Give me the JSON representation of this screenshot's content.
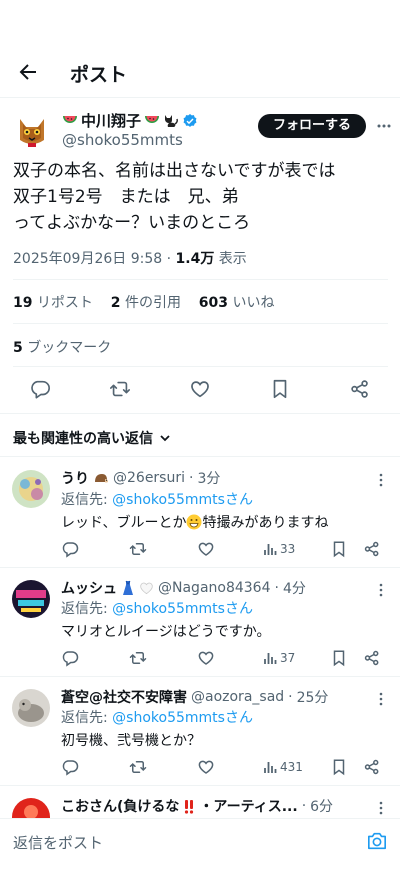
{
  "header": {
    "title": "ポスト"
  },
  "post": {
    "display_name": "中川翔子",
    "handle": "@shoko55mmts",
    "follow_label": "フォローする",
    "text": "双子の本名、名前は出さないですが表では\n双子1号2号　または　兄、弟\nってよぶかなー？いまのところ",
    "date": "2025年09月26日 9:58",
    "views_count": "1.4万",
    "views_label": "表示",
    "retweets_count": "19",
    "retweets_label": "リポスト",
    "quotes_count": "2",
    "quotes_label": "件の引用",
    "likes_count": "603",
    "likes_label": "いいね",
    "bookmarks_count": "5",
    "bookmarks_label": "ブックマーク"
  },
  "replies_sort": {
    "label": "最も関連性の高い返信"
  },
  "replies": [
    {
      "name": "うり",
      "handle": "@26ersuri",
      "time": "3分",
      "reply_to_prefix": "返信先: ",
      "reply_to": "@shoko55mmtsさん",
      "text_before": "レッド、ブルーとか",
      "text_after": "特撮みがありますね",
      "views": "33"
    },
    {
      "name": "ムッシュ",
      "handle": "@Nagano84364",
      "time": "4分",
      "reply_to_prefix": "返信先: ",
      "reply_to": "@shoko55mmtsさん",
      "text": "マリオとルイージはどうですか。",
      "views": "37"
    },
    {
      "name": "蒼空@社交不安障害",
      "handle": "@aozora_sad",
      "time": "25分",
      "reply_to_prefix": "返信先: ",
      "reply_to": "@shoko55mmtsさん",
      "text": "初号機、弐号機とか？",
      "views": "431"
    },
    {
      "name": "こおさん(負けるな",
      "name_suffix": "・アーティス...",
      "time": "6分"
    }
  ],
  "composer": {
    "placeholder": "返信をポスト"
  },
  "colors": {
    "accent": "#1d9bf0",
    "text": "#0f1419",
    "muted": "#536471",
    "border": "#eff3f4"
  }
}
